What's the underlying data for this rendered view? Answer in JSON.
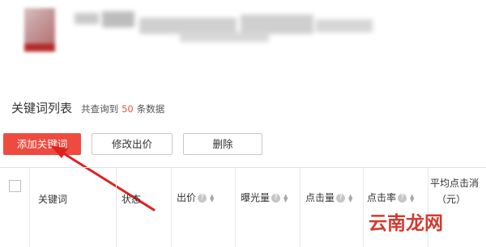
{
  "list": {
    "title": "关键词列表",
    "summary_prefix": "共查询到",
    "count": "50",
    "summary_suffix": "条数据"
  },
  "toolbar": {
    "add_label": "添加关键词",
    "edit_price_label": "修改出价",
    "delete_label": "删除",
    "accent_color": "#ee4a3f"
  },
  "table": {
    "headers": {
      "keyword": "关键词",
      "status": "状态",
      "bid": "出价",
      "impressions": "曝光量",
      "clicks": "点击量",
      "ctr": "点击率",
      "avg_cost_line1": "平均点击消",
      "avg_cost_line2": "（元）"
    }
  },
  "watermark": "云南龙网"
}
